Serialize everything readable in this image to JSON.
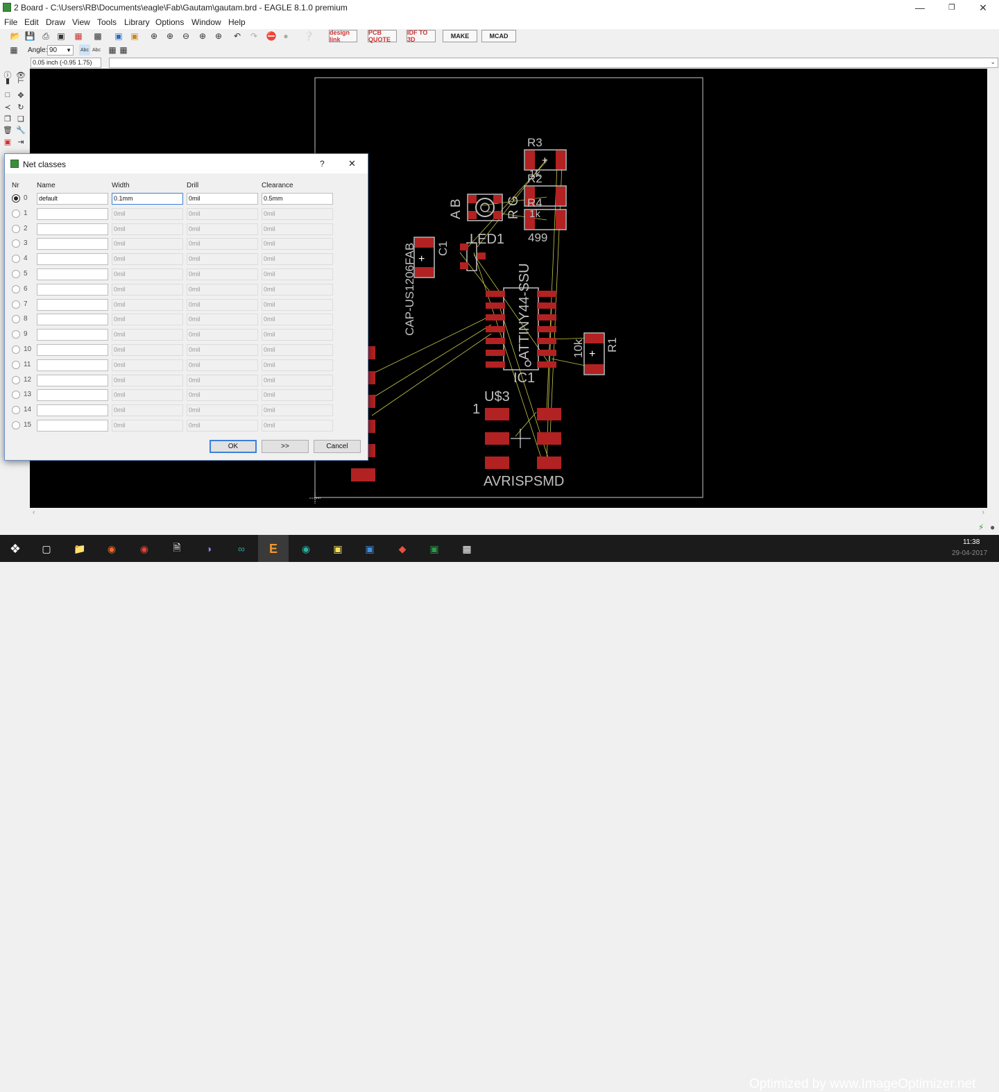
{
  "window": {
    "title": "2 Board - C:\\Users\\RB\\Documents\\eagle\\Fab\\Gautam\\gautam.brd - EAGLE 8.1.0 premium",
    "minimize": "—",
    "maximize": "❐",
    "close": "✕"
  },
  "menu": [
    "File",
    "Edit",
    "Draw",
    "View",
    "Tools",
    "Library",
    "Options",
    "Window",
    "Help"
  ],
  "toolbar": {
    "design_link": "design link",
    "pcb_quote": "PCB QUOTE",
    "idf_3d": "IDF TO 3D",
    "make": "MAKE",
    "mcad": "MCAD"
  },
  "toolbar2": {
    "angle_label": "Angle:",
    "angle_value": "90"
  },
  "coordinate_readout": "0.05 inch (-0.95 1.75)",
  "board": {
    "labels": {
      "r3": "R3",
      "r2": "R2",
      "r4": "R4",
      "r1": "R1",
      "r2_value": "1k",
      "r4_value": "1k",
      "r1_value": "10k",
      "value_499": "499",
      "led1": "LED1",
      "ab": "A B",
      "rg": "R G",
      "c1": "C1",
      "cap": "CAP-US1206FAB",
      "attiny": "ATTINY44-SSU",
      "ic1": "IC1",
      "u3": "U$3",
      "pin1": "1",
      "avrisp": "AVRISPSMD"
    }
  },
  "dialog": {
    "title": "Net classes",
    "help": "?",
    "close": "✕",
    "columns": [
      "Nr",
      "Name",
      "Width",
      "Drill",
      "Clearance"
    ],
    "rows": [
      {
        "nr": "0",
        "name": "default",
        "width": "0.1mm",
        "drill": "0mil",
        "clearance": "0.5mm",
        "selected": true
      },
      {
        "nr": "1",
        "name": "",
        "width": "0mil",
        "drill": "0mil",
        "clearance": "0mil"
      },
      {
        "nr": "2",
        "name": "",
        "width": "0mil",
        "drill": "0mil",
        "clearance": "0mil"
      },
      {
        "nr": "3",
        "name": "",
        "width": "0mil",
        "drill": "0mil",
        "clearance": "0mil"
      },
      {
        "nr": "4",
        "name": "",
        "width": "0mil",
        "drill": "0mil",
        "clearance": "0mil"
      },
      {
        "nr": "5",
        "name": "",
        "width": "0mil",
        "drill": "0mil",
        "clearance": "0mil"
      },
      {
        "nr": "6",
        "name": "",
        "width": "0mil",
        "drill": "0mil",
        "clearance": "0mil"
      },
      {
        "nr": "7",
        "name": "",
        "width": "0mil",
        "drill": "0mil",
        "clearance": "0mil"
      },
      {
        "nr": "8",
        "name": "",
        "width": "0mil",
        "drill": "0mil",
        "clearance": "0mil"
      },
      {
        "nr": "9",
        "name": "",
        "width": "0mil",
        "drill": "0mil",
        "clearance": "0mil"
      },
      {
        "nr": "10",
        "name": "",
        "width": "0mil",
        "drill": "0mil",
        "clearance": "0mil"
      },
      {
        "nr": "11",
        "name": "",
        "width": "0mil",
        "drill": "0mil",
        "clearance": "0mil"
      },
      {
        "nr": "12",
        "name": "",
        "width": "0mil",
        "drill": "0mil",
        "clearance": "0mil"
      },
      {
        "nr": "13",
        "name": "",
        "width": "0mil",
        "drill": "0mil",
        "clearance": "0mil"
      },
      {
        "nr": "14",
        "name": "",
        "width": "0mil",
        "drill": "0mil",
        "clearance": "0mil"
      },
      {
        "nr": "15",
        "name": "",
        "width": "0mil",
        "drill": "0mil",
        "clearance": "0mil"
      }
    ],
    "buttons": {
      "ok": "OK",
      "more": ">>",
      "cancel": "Cancel"
    }
  },
  "taskbar": {
    "watermark": "Optimized by www.ImageOptimizer.net",
    "time": "11:38",
    "date": "29-04-2017"
  },
  "colors": {
    "canvas_bg": "#000000",
    "pad_red": "#b22222",
    "airwire": "#c8c84a",
    "silkscreen": "#c0c0c0"
  }
}
